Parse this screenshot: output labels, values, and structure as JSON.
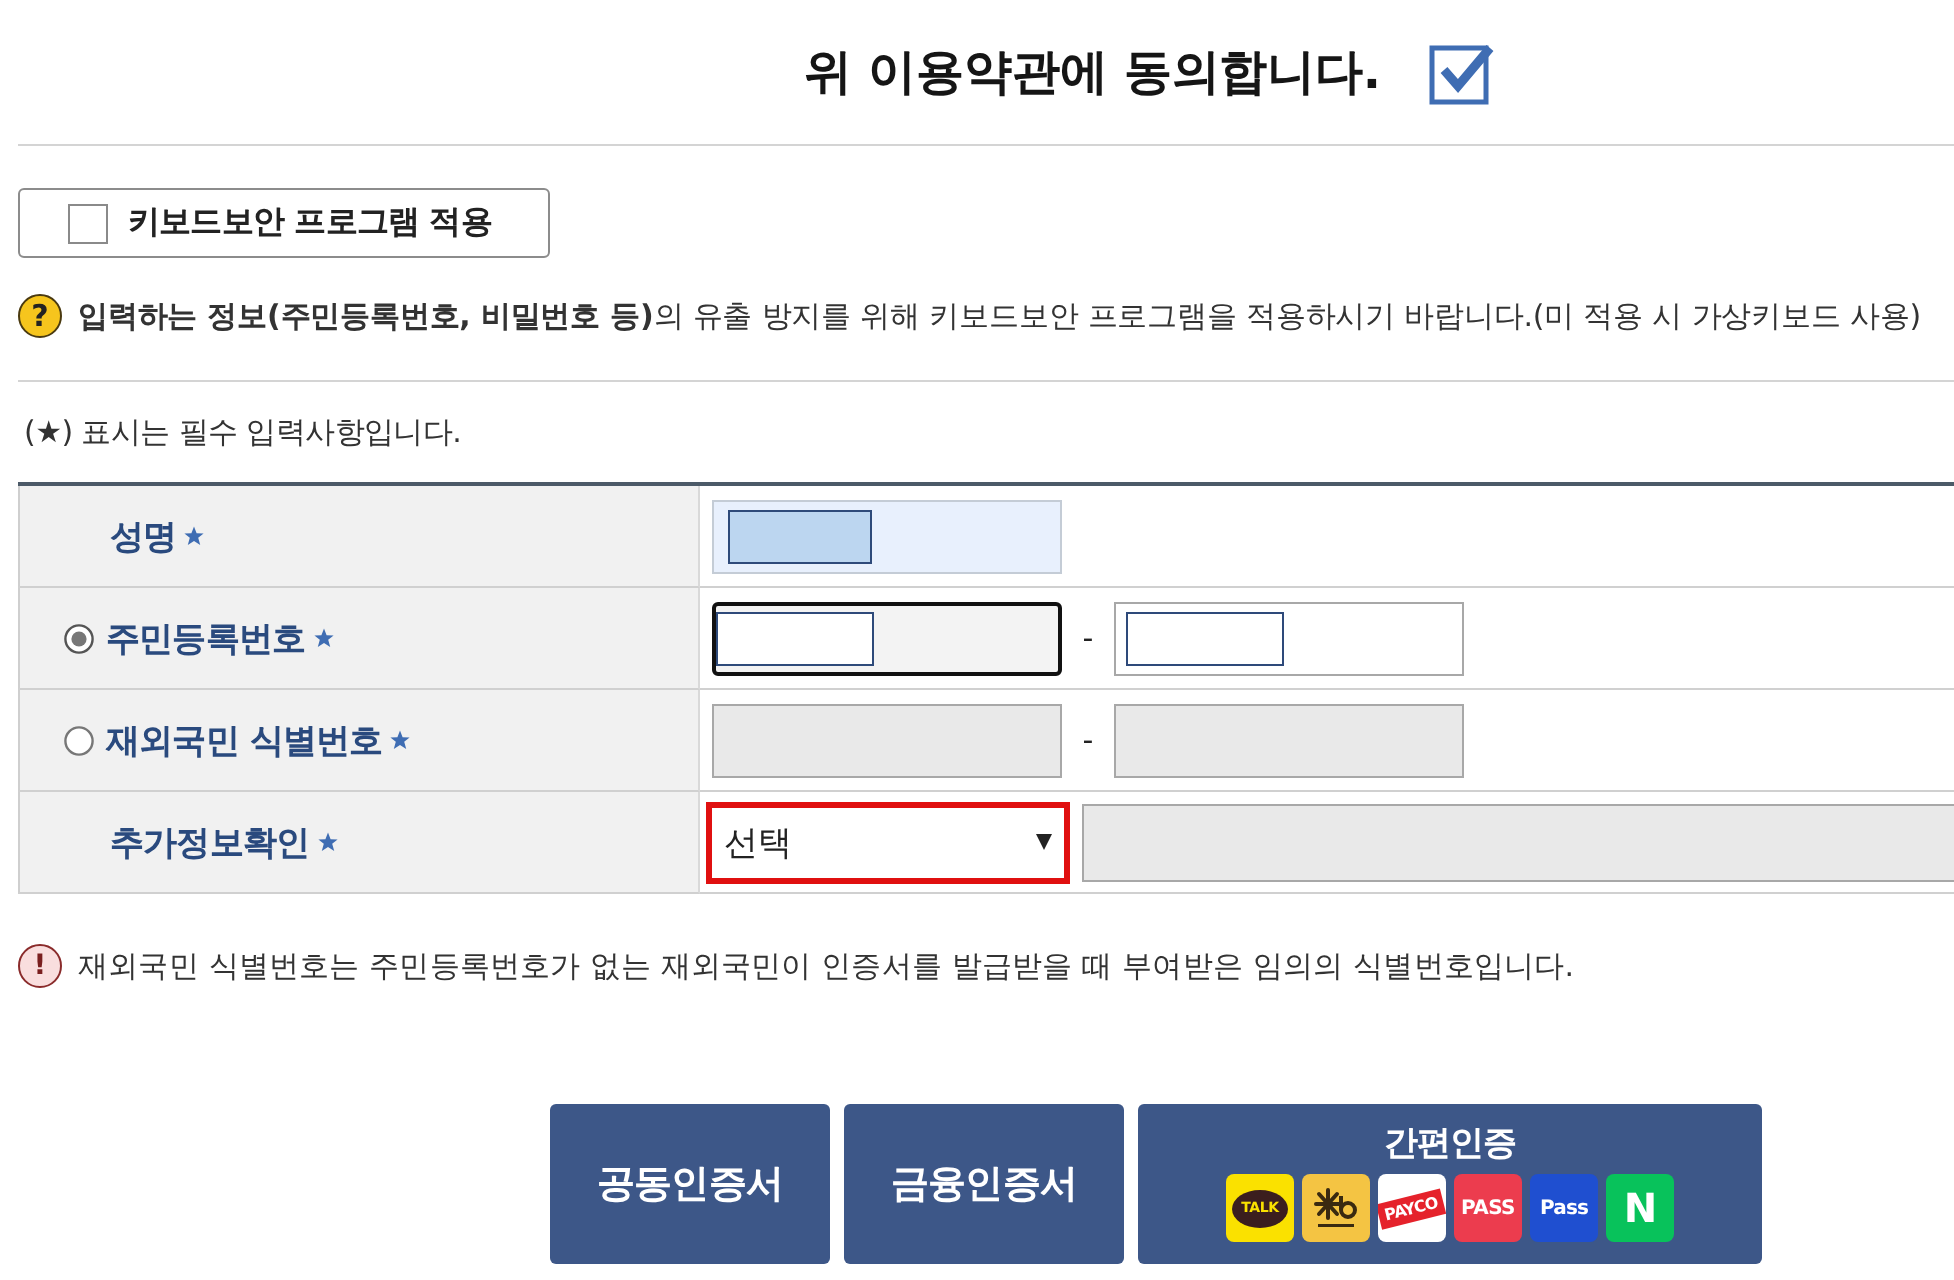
{
  "agreement": {
    "label": "위 이용약관에 동의합니다.",
    "checked": true
  },
  "keyboard_security": {
    "label": "키보드보안 프로그램 적용",
    "checked": false
  },
  "notice": {
    "icon": "?",
    "text": "**입력하는 정보(주민등록번호, 비밀번호 등)**의 유출 방지를 위해 키보드보안 프로그램을 적용하시기 바랍니다.(미 적용 시 가상키보드 사용)"
  },
  "required_note": "(*★*) 표시는 필수 입력사항입니다.",
  "rows": [
    {
      "kind": "single",
      "label": "성명",
      "required": true,
      "fields": [
        {
          "highlighted": true,
          "focused": false,
          "disabled": false
        }
      ]
    },
    {
      "kind": "split",
      "label": "주민등록번호",
      "required": true,
      "selected": true,
      "fields": [
        {
          "highlighted": false,
          "focused": true,
          "disabled": false
        },
        {
          "highlighted": false,
          "focused": false,
          "disabled": false
        }
      ],
      "separator": "-"
    },
    {
      "kind": "split",
      "label": "재외국민 식별번호",
      "required": true,
      "selected": false,
      "fields": [
        {
          "highlighted": false,
          "focused": false,
          "disabled": true
        },
        {
          "highlighted": false,
          "focused": false,
          "disabled": true
        }
      ],
      "separator": "-"
    },
    {
      "kind": "select",
      "label": "추가정보확인",
      "required": true,
      "select": {
        "value": "선택",
        "error": true
      },
      "fields": [
        {
          "highlighted": false,
          "focused": false,
          "disabled": true
        }
      ]
    }
  ],
  "warning": {
    "icon": "!",
    "text": "재외국민 식별번호는 주민등록번호가 없는 재외국민이 인증서를 발급받을 때 부여받은 임의의 식별번호입니다."
  },
  "auth_buttons": [
    {
      "kind": "plain",
      "label": "공동인증서"
    },
    {
      "kind": "plain",
      "label": "금융인증서"
    },
    {
      "kind": "providers",
      "label": "간편인증",
      "providers": [
        {
          "kind": "talk",
          "text": "TALK"
        },
        {
          "kind": "star"
        },
        {
          "kind": "ribbon",
          "text": "PAYCO"
        },
        {
          "kind": "pass",
          "text": "PASS"
        },
        {
          "kind": "pass_blue",
          "text": "Pass"
        },
        {
          "kind": "letter",
          "text": "N"
        }
      ]
    }
  ]
}
